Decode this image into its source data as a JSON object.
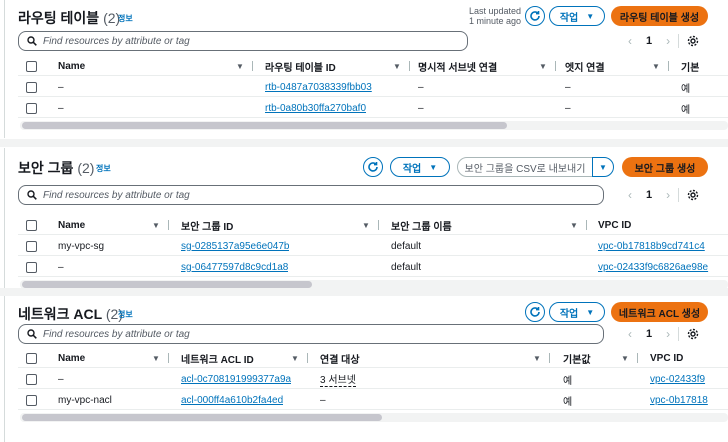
{
  "route_tables": {
    "title": "라우팅 테이블",
    "count": "(2)",
    "info": "정보",
    "last_updated_line1": "Last updated",
    "last_updated_line2": "1 minute ago",
    "actions_label": "작업",
    "create_label": "라우팅 테이블 생성",
    "search_placeholder": "Find resources by attribute or tag",
    "page": "1",
    "columns": [
      "Name",
      "라우팅 테이블 ID",
      "명시적 서브넷 연결",
      "엣지 연결",
      "기본"
    ],
    "rows": [
      {
        "name": "–",
        "id": "rtb-0487a7038339fbb03",
        "subnet": "–",
        "edge": "–",
        "main": "예"
      },
      {
        "name": "–",
        "id": "rtb-0a80b30ffa270baf0",
        "subnet": "–",
        "edge": "–",
        "main": "예"
      }
    ]
  },
  "security_groups": {
    "title": "보안 그룹",
    "count": "(2)",
    "info": "정보",
    "actions_label": "작업",
    "export_label": "보안 그룹을 CSV로 내보내기",
    "create_label": "보안 그룹 생성",
    "search_placeholder": "Find resources by attribute or tag",
    "page": "1",
    "columns": [
      "Name",
      "보안 그룹 ID",
      "보안 그룹 이름",
      "VPC ID"
    ],
    "rows": [
      {
        "name": "my-vpc-sg",
        "id": "sg-0285137a95e6e047b",
        "group_name": "default",
        "vpc": "vpc-0b17818b9cd741c4"
      },
      {
        "name": "–",
        "id": "sg-06477597d8c9cd1a8",
        "group_name": "default",
        "vpc": "vpc-02433f9c6826ae98e"
      }
    ]
  },
  "network_acls": {
    "title": "네트워크 ACL",
    "count": "(2)",
    "info": "정보",
    "actions_label": "작업",
    "create_label": "네트워크 ACL 생성",
    "search_placeholder": "Find resources by attribute or tag",
    "page": "1",
    "columns": [
      "Name",
      "네트워크 ACL ID",
      "연결 대상",
      "기본값",
      "VPC ID"
    ],
    "rows": [
      {
        "name": "–",
        "id": "acl-0c708191999377a9a",
        "assoc": "3 서브넷",
        "default": "예",
        "vpc": "vpc-02433f9"
      },
      {
        "name": "my-vpc-nacl",
        "id": "acl-000ff4a610b2fa4ed",
        "assoc": "–",
        "default": "예",
        "vpc": "vpc-0b17818"
      }
    ]
  },
  "colors": {
    "accent": "#0073bb",
    "primary": "#ec7211"
  }
}
